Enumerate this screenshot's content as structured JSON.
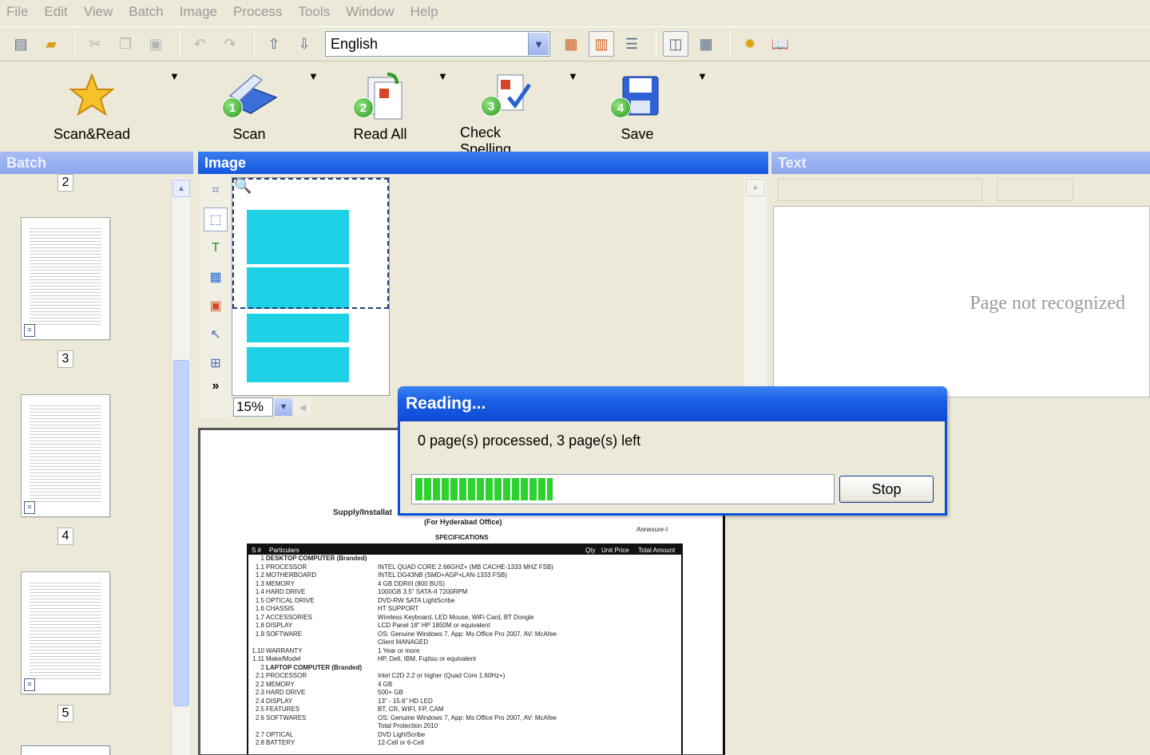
{
  "menu": [
    "File",
    "Edit",
    "View",
    "Batch",
    "Image",
    "Process",
    "Tools",
    "Window",
    "Help"
  ],
  "toolbar": {
    "language": "English",
    "icons": [
      "open-batch-icon",
      "open-image-icon",
      "cut-icon",
      "copy-icon",
      "paste-icon",
      "undo-icon",
      "redo-icon",
      "import-icon",
      "export-icon",
      "image-view-icon",
      "split-view-icon",
      "text-view-icon",
      "two-page-icon",
      "table-view-icon",
      "options-icon",
      "help-book-icon"
    ]
  },
  "big_buttons": [
    {
      "label": "Scan&Read",
      "icon": "star-icon"
    },
    {
      "label": "Scan",
      "step": "1",
      "icon": "scanner-icon"
    },
    {
      "label": "Read All",
      "step": "2",
      "icon": "read-pages-icon"
    },
    {
      "label": "Check Spelling",
      "step": "3",
      "icon": "spelling-check-icon"
    },
    {
      "label": "Save",
      "step": "4",
      "icon": "floppy-disk-icon"
    }
  ],
  "panels": {
    "batch": "Batch",
    "image": "Image",
    "text": "Text"
  },
  "batch_pages": [
    "2",
    "3",
    "4",
    "5"
  ],
  "image": {
    "zoom": "15%"
  },
  "document": {
    "title": "Supply/Installat",
    "subtitle": "(For Hyderabad Office)",
    "specs": "SPECIFICATIONS",
    "annex": "Annexure-I",
    "header_cols": [
      "S #",
      "Particulars",
      "Qty",
      "Unit Price",
      "Total Amount"
    ],
    "rows": [
      [
        "1",
        "DESKTOP COMPUTER (Branded)",
        ""
      ],
      [
        "1.1",
        "PROCESSOR",
        "INTEL QUAD CORE 2.66GHZ+ (MB CACHE-1333 MHZ FSB)"
      ],
      [
        "1.2",
        "MOTHERBOARD",
        "INTEL DG43NB (SMD+AGP+LAN-1333 FSB)"
      ],
      [
        "1.3",
        "MEMORY",
        "4 GB DDRIII (800 BUS)"
      ],
      [
        "1.4",
        "HARD DRIVE",
        "1000GB 3.5\" SATA-II 7200RPM"
      ],
      [
        "1.5",
        "OPTICAL DRIVE",
        "DVD-RW SATA LightScribe"
      ],
      [
        "1.6",
        "CHASSIS",
        "HT SUPPORT"
      ],
      [
        "1.7",
        "ACCESSORIES",
        "Wireless Keyboard, LED Mouse, WiFi Card, BT Dongle"
      ],
      [
        "1.8",
        "DISPLAY",
        "LCD Panel 18\" HP 1850M or equivalent"
      ],
      [
        "1.9",
        "SOFTWARE",
        "OS: Genuine Windows 7, App: Ms Office Pro 2007, AV: McAfee"
      ],
      [
        "",
        "",
        "Client MANAGED"
      ],
      [
        "1.10",
        "WARRANTY",
        "1 Year or more"
      ],
      [
        "1.11",
        "Make/Model",
        "HP, Dell, IBM, Fujitsu or equivalent"
      ],
      [
        "2",
        "LAPTOP COMPUTER (Branded)",
        ""
      ],
      [
        "2.1",
        "PROCESSOR",
        "Intel C2D 2.2 or higher (Quad Core 1.60Hz+)"
      ],
      [
        "2.2",
        "MEMORY",
        "4 GB"
      ],
      [
        "2.3",
        "HARD DRIVE",
        "500+ GB"
      ],
      [
        "2.4",
        "DISPLAY",
        "13\" - 15.6\" HD LED"
      ],
      [
        "2.5",
        "FEATURES",
        "BT, CR, WIFI, FP, CAM"
      ],
      [
        "2.6",
        "SOFTWARES",
        "OS: Genuine Windows 7, App: Ms Office Pro 2007, AV: McAfee"
      ],
      [
        "",
        "",
        "Total Protection 2010"
      ],
      [
        "2.7",
        "OPTICAL",
        "DVD LightScribe"
      ],
      [
        "2.8",
        "BATTERY",
        "12-Cell or 6-Cell"
      ]
    ]
  },
  "text_panel": {
    "status": "Page not recognized"
  },
  "dialog": {
    "title": "Reading...",
    "message": "0 page(s) processed, 3 page(s) left",
    "progress": 0.33,
    "stop_label": "Stop"
  },
  "colors": {
    "title_blue": "#1458e0",
    "progress_green": "#2ed22e",
    "highlight_cyan": "#1ed0e4"
  }
}
